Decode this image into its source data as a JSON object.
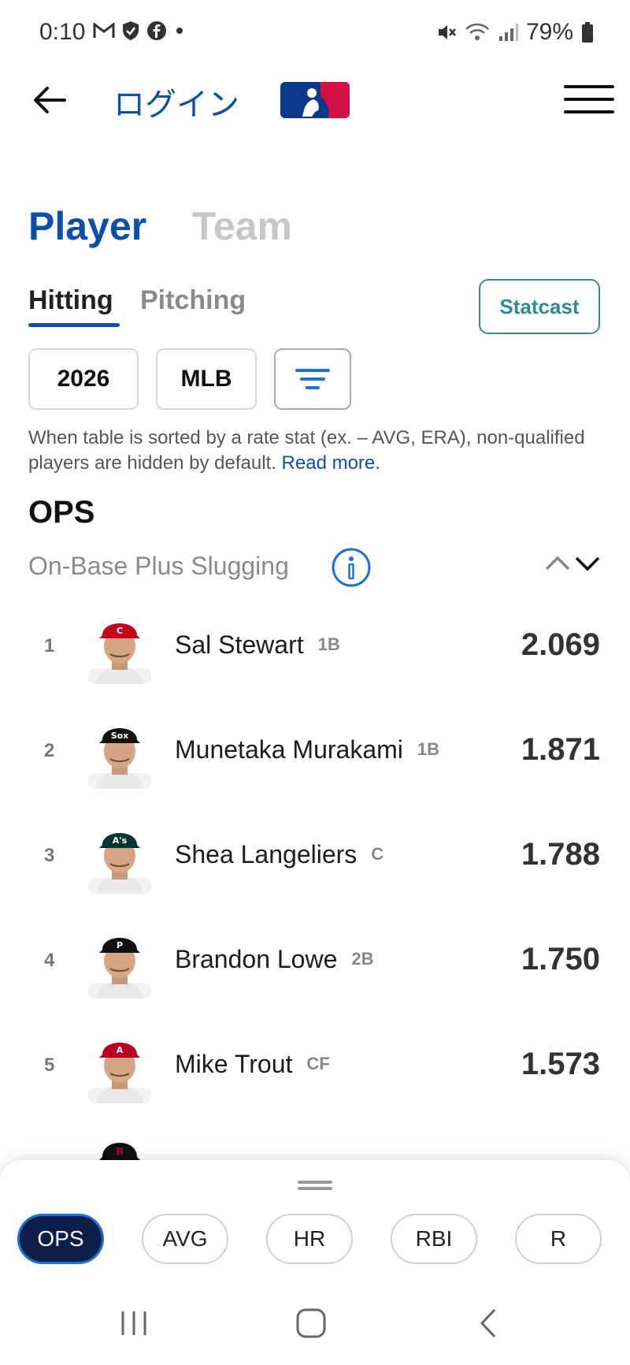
{
  "status_bar": {
    "time": "0:10",
    "battery": "79%"
  },
  "header": {
    "login_label": "ログイン"
  },
  "tabs": {
    "player": "Player",
    "team": "Team"
  },
  "subtabs": {
    "hitting": "Hitting",
    "pitching": "Pitching",
    "statcast": "Statcast"
  },
  "filters": {
    "year": "2026",
    "league": "MLB"
  },
  "note": {
    "text": "When table is sorted by a rate stat (ex. – AVG, ERA), non-qualified players are hidden by default.",
    "link": "Read more."
  },
  "stat": {
    "title": "OPS",
    "subtitle": "On-Base Plus Slugging"
  },
  "players": [
    {
      "rank": "1",
      "name": "Sal Stewart",
      "position": "1B",
      "value": "2.069",
      "cap_color": "#c6011f",
      "cap_logo": "C"
    },
    {
      "rank": "2",
      "name": "Munetaka Murakami",
      "position": "1B",
      "value": "1.871",
      "cap_color": "#111111",
      "cap_logo": "Sox"
    },
    {
      "rank": "3",
      "name": "Shea Langeliers",
      "position": "C",
      "value": "1.788",
      "cap_color": "#003831",
      "cap_logo": "A's"
    },
    {
      "rank": "4",
      "name": "Brandon Lowe",
      "position": "2B",
      "value": "1.750",
      "cap_color": "#111111",
      "cap_logo": "P"
    },
    {
      "rank": "5",
      "name": "Mike Trout",
      "position": "CF",
      "value": "1.573",
      "cap_color": "#ba0021",
      "cap_logo": "A"
    }
  ],
  "stat_pills": [
    "OPS",
    "AVG",
    "HR",
    "RBI",
    "R"
  ],
  "colors": {
    "accent": "#0a4fa8",
    "statcast": "#2f8a95",
    "active_pill": "#0b1f4a"
  }
}
